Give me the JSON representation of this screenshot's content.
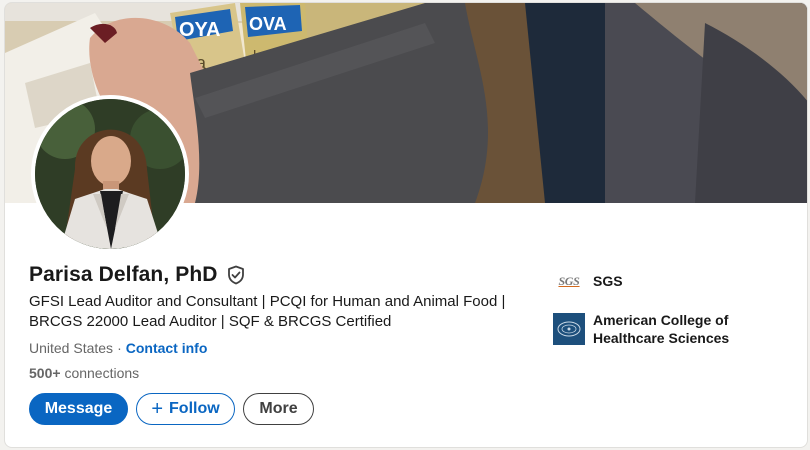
{
  "profile": {
    "name": "Parisa Delfan, PhD",
    "headline": "GFSI Lead Auditor and Consultant | PCQI for Human and Animal Food | BRCGS 22000 Lead Auditor | SQF & BRCGS Certified",
    "location": "United States",
    "separator": "·",
    "contact_label": "Contact info",
    "connections_count": "500+",
    "connections_label": "connections"
  },
  "banner": {
    "visible_text": [
      "OYA",
      "OVA",
      "ca",
      "lantain"
    ]
  },
  "actions": {
    "message_label": "Message",
    "follow_label": "Follow",
    "follow_icon": "+",
    "more_label": "More"
  },
  "organizations": [
    {
      "name": "SGS",
      "logo_text": "SGS",
      "icon": "sgs-logo"
    },
    {
      "name": "American College of Healthcare Sciences",
      "icon": "acs-seal-logo"
    }
  ],
  "icons": {
    "verified": "shield-check-icon"
  },
  "colors": {
    "accent": "#0a66c2",
    "text": "#191919",
    "muted": "#666666"
  }
}
